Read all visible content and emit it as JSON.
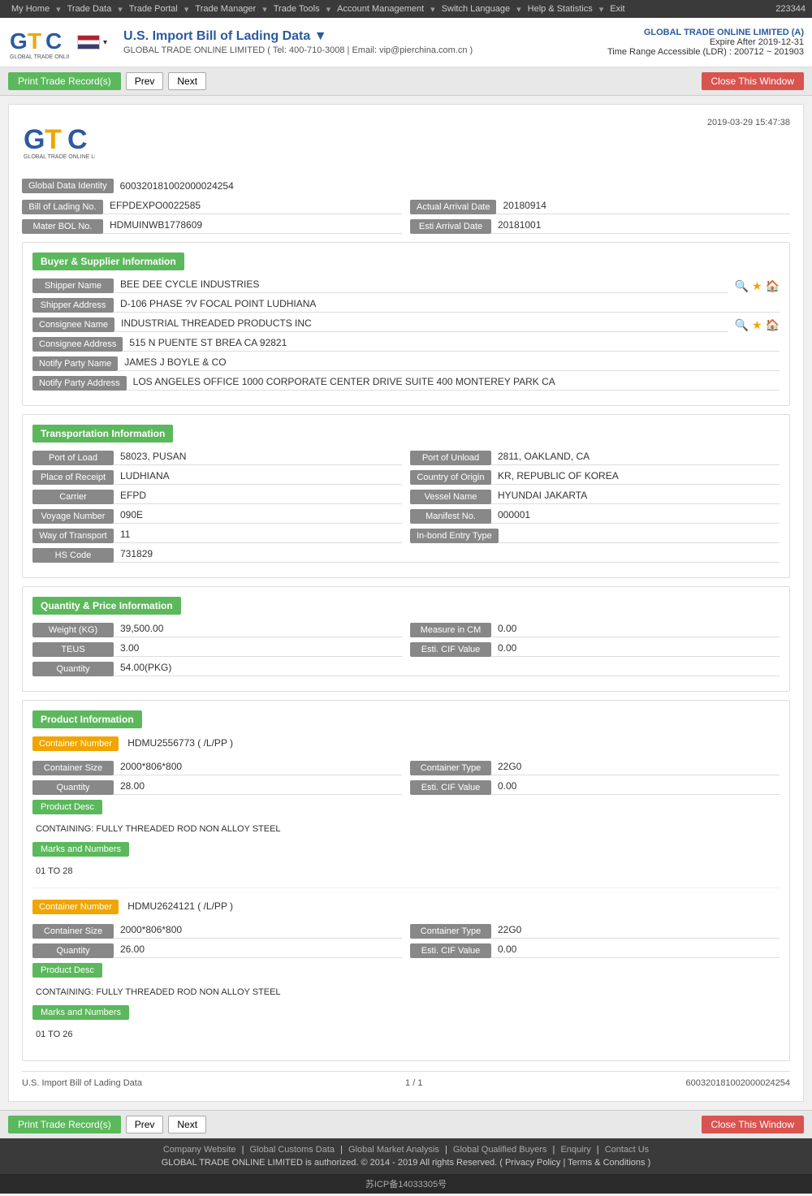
{
  "topnav": {
    "items": [
      "My Home",
      "Trade Data",
      "Trade Portal",
      "Trade Manager",
      "Trade Tools",
      "Account Management",
      "Switch Language",
      "Help & Statistics",
      "Exit"
    ],
    "account_id": "223344"
  },
  "header": {
    "title": "U.S. Import Bill of Lading Data ▼",
    "subtitle": "GLOBAL TRADE ONLINE LIMITED ( Tel: 400-710-3008 | Email: vip@pierchina.com.cn )",
    "account_name": "GLOBAL TRADE ONLINE LIMITED (A)",
    "expire": "Expire After 2019-12-31",
    "time_range": "Time Range Accessible (LDR) : 200712 ~ 201903",
    "flag_label": "US Flag"
  },
  "toolbar": {
    "print_label": "Print Trade Record(s)",
    "prev_label": "Prev",
    "next_label": "Next",
    "close_label": "Close This Window"
  },
  "document": {
    "logo_subtitle": "GLOBAL TRADE ONLINE LIMITED",
    "date": "2019-03-29 15:47:38",
    "global_data_identity_label": "Global Data Identity",
    "global_data_identity_value": "600320181002000024254",
    "bill_of_lading_no_label": "Bill of Lading No.",
    "bill_of_lading_no_value": "EFPDEXPO0022585",
    "actual_arrival_date_label": "Actual Arrival Date",
    "actual_arrival_date_value": "20180914",
    "master_bol_label": "Mater BOL No.",
    "master_bol_value": "HDMUINWB1778609",
    "esti_arrival_date_label": "Esti Arrival Date",
    "esti_arrival_date_value": "20181001"
  },
  "buyer_supplier": {
    "section_title": "Buyer & Supplier Information",
    "shipper_name_label": "Shipper Name",
    "shipper_name_value": "BEE DEE CYCLE INDUSTRIES",
    "shipper_address_label": "Shipper Address",
    "shipper_address_value": "D-106 PHASE ?V FOCAL POINT LUDHIANA",
    "consignee_name_label": "Consignee Name",
    "consignee_name_value": "INDUSTRIAL THREADED PRODUCTS INC",
    "consignee_address_label": "Consignee Address",
    "consignee_address_value": "515 N PUENTE ST BREA CA 92821",
    "notify_party_name_label": "Notify Party Name",
    "notify_party_name_value": "JAMES J BOYLE & CO",
    "notify_party_address_label": "Notify Party Address",
    "notify_party_address_value": "LOS ANGELES OFFICE 1000 CORPORATE CENTER DRIVE SUITE 400 MONTEREY PARK CA"
  },
  "transportation": {
    "section_title": "Transportation Information",
    "port_of_load_label": "Port of Load",
    "port_of_load_value": "58023, PUSAN",
    "port_of_unload_label": "Port of Unload",
    "port_of_unload_value": "2811, OAKLAND, CA",
    "place_of_receipt_label": "Place of Receipt",
    "place_of_receipt_value": "LUDHIANA",
    "country_of_origin_label": "Country of Origin",
    "country_of_origin_value": "KR, REPUBLIC OF KOREA",
    "carrier_label": "Carrier",
    "carrier_value": "EFPD",
    "vessel_name_label": "Vessel Name",
    "vessel_name_value": "HYUNDAI JAKARTA",
    "voyage_number_label": "Voyage Number",
    "voyage_number_value": "090E",
    "manifest_no_label": "Manifest No.",
    "manifest_no_value": "000001",
    "way_of_transport_label": "Way of Transport",
    "way_of_transport_value": "11",
    "inbond_entry_type_label": "In-bond Entry Type",
    "inbond_entry_type_value": "",
    "hs_code_label": "HS Code",
    "hs_code_value": "731829"
  },
  "quantity_price": {
    "section_title": "Quantity & Price Information",
    "weight_kg_label": "Weight (KG)",
    "weight_kg_value": "39,500.00",
    "measure_in_cm_label": "Measure in CM",
    "measure_in_cm_value": "0.00",
    "teus_label": "TEUS",
    "teus_value": "3.00",
    "esti_cif_value_label": "Esti. CIF Value",
    "esti_cif_value_value": "0.00",
    "quantity_label": "Quantity",
    "quantity_value": "54.00(PKG)"
  },
  "product_information": {
    "section_title": "Product Information",
    "containers": [
      {
        "container_number_label": "Container Number",
        "container_number_value": "HDMU2556773 ( /L/PP )",
        "container_size_label": "Container Size",
        "container_size_value": "2000*806*800",
        "container_type_label": "Container Type",
        "container_type_value": "22G0",
        "quantity_label": "Quantity",
        "quantity_value": "28.00",
        "esti_cif_label": "Esti. CIF Value",
        "esti_cif_value": "0.00",
        "product_desc_label": "Product Desc",
        "product_desc_text": "CONTAINING: FULLY THREADED ROD NON ALLOY STEEL",
        "marks_label": "Marks and Numbers",
        "marks_text": "01 TO 28"
      },
      {
        "container_number_label": "Container Number",
        "container_number_value": "HDMU2624121 ( /L/PP )",
        "container_size_label": "Container Size",
        "container_size_value": "2000*806*800",
        "container_type_label": "Container Type",
        "container_type_value": "22G0",
        "quantity_label": "Quantity",
        "quantity_value": "26.00",
        "esti_cif_label": "Esti. CIF Value",
        "esti_cif_value": "0.00",
        "product_desc_label": "Product Desc",
        "product_desc_text": "CONTAINING: FULLY THREADED ROD NON ALLOY STEEL",
        "marks_label": "Marks and Numbers",
        "marks_text": "01 TO 26"
      }
    ]
  },
  "doc_footer": {
    "left": "U.S. Import Bill of Lading Data",
    "center": "1 / 1",
    "right": "600320181002000024254"
  },
  "site_footer": {
    "links": [
      "Company Website",
      "Global Customs Data",
      "Global Market Analysis",
      "Global Qualified Buyers",
      "Enquiry",
      "Contact Us"
    ],
    "copyright": "GLOBAL TRADE ONLINE LIMITED is authorized. © 2014 - 2019 All rights Reserved. ( Privacy Policy | Terms & Conditions )",
    "icp": "苏ICP备14033305号"
  }
}
